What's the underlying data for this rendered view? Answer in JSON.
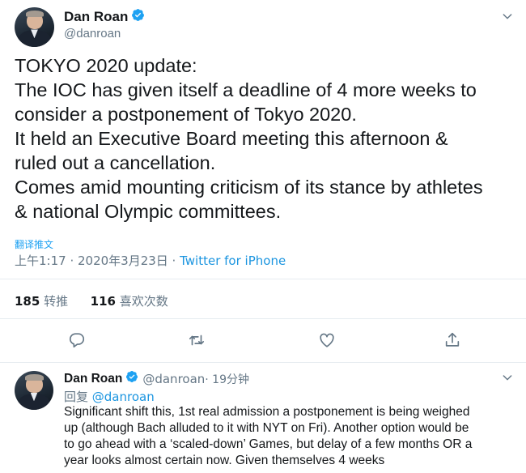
{
  "main_tweet": {
    "author": {
      "name": "Dan Roan",
      "handle": "@danroan"
    },
    "lines": [
      "TOKYO 2020 update:",
      "The IOC has given itself a deadline of 4 more weeks to",
      "consider a postponement of Tokyo 2020.",
      "It held an Executive Board meeting this afternoon &",
      "ruled out a cancellation.",
      "Comes amid mounting criticism of its stance by athletes",
      "& national Olympic committees."
    ],
    "translate_label": "翻译推文",
    "timestamp": "上午1:17 · 2020年3月23日 · ",
    "source": "Twitter for iPhone",
    "stats": {
      "retweets": {
        "count": "185",
        "label": "转推"
      },
      "likes": {
        "count": "116",
        "label": "喜欢次数"
      }
    }
  },
  "reply_tweet": {
    "author": {
      "name": "Dan Roan",
      "handle": "@danroan",
      "time": " · 19分钟"
    },
    "reply_prefix": "回复 ",
    "reply_mention": "@danroan",
    "lines": [
      "Significant shift this, 1st real admission a postponement is being weighed",
      "up (although Bach alluded to it with NYT on Fri). Another option would be",
      "to go ahead with a ‘scaled-down’ Games, but delay of a few months OR a",
      "year looks almost certain now. Given themselves 4 weeks"
    ]
  },
  "icons": {
    "verified": "verified-badge-icon",
    "caret": "chevron-down-icon",
    "reply": "reply-icon",
    "retweet": "retweet-icon",
    "like": "like-icon",
    "share": "share-icon"
  },
  "colors": {
    "accent": "#1da1f2",
    "link": "#1b95e0",
    "secondary_text": "#657786",
    "divider": "#e6ecf0",
    "primary_text": "#14171a"
  }
}
